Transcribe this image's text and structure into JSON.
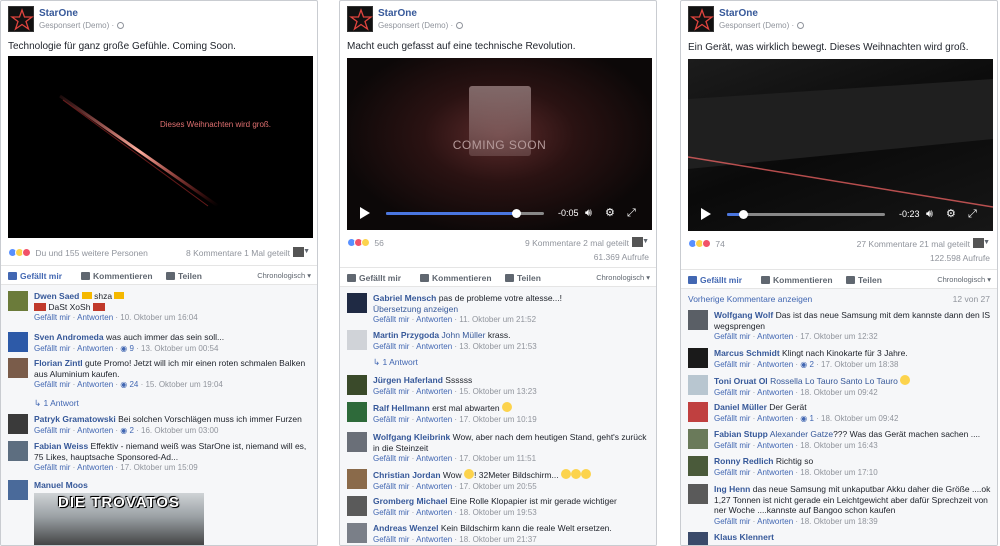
{
  "page_name": "StarOne",
  "sponsored": "Gesponsert (Demo) ·",
  "actions": {
    "like": "Gefällt mir",
    "comment": "Kommentieren",
    "share": "Teilen",
    "sort": "Chronologisch ▾"
  },
  "meta": {
    "like": "Gefällt mir",
    "reply": "Antworten"
  },
  "colors": {
    "link": "#365899",
    "accent": "#4267b2",
    "muted": "#90949c",
    "progress": "#4a76e0"
  },
  "posts": [
    {
      "text": "Technologie für ganz große Gefühle. Coming Soon.",
      "video_text": "Dieses Weihnachten wird groß.",
      "reactions": "Du und 155 weitere Personen",
      "counts": "8 Kommentare  1 Mal geteilt",
      "comments": [
        {
          "name": "Dwen Saed",
          "text": "shza",
          "extra": "DaSt XoSh",
          "time": "10. Oktober um 16:04",
          "likes": ""
        },
        {
          "name": "Sven Andromeda",
          "text": "was auch immer das sein soll...",
          "time": "13. Oktober um 00:54",
          "likes": "9"
        },
        {
          "name": "Florian Zintl",
          "text": "gute Promo! Jetzt will ich mir einen roten schmalen Balken aus Aluminium kaufen.",
          "time": "15. Oktober um 19:04",
          "likes": "24"
        },
        {
          "name": "Patryk Gramatowski",
          "text": "Bei solchen Vorschlägen muss ich immer Furzen",
          "time": "16. Oktober um 03:00",
          "likes": "2"
        },
        {
          "name": "Fabian Weiss",
          "text": "Effektiv - niemand weiß was StarOne ist, niemand will es, 75 Likes, hauptsache Sponsored-Ad...",
          "time": "17. Oktober um 15:09",
          "likes": ""
        },
        {
          "name": "Manuel Moos",
          "text": "",
          "time": "",
          "likes": ""
        }
      ],
      "reply_link": "1 Antwort",
      "image_text": "DIE TROVATOS"
    },
    {
      "text": "Macht euch gefasst auf eine technische Revolution.",
      "video_text": "COMING SOON",
      "time_left": "-0:05",
      "reactions": "56",
      "counts": "9 Kommentare  2 mal geteilt",
      "views": "61.369 Aufrufe",
      "comments": [
        {
          "name": "Gabriel Mensch",
          "text": "pas de probleme votre altesse...!",
          "sub": "Übersetzung anzeigen",
          "time": "11. Oktober um 21:52",
          "likes": ""
        },
        {
          "name": "Martin Przygoda",
          "tag": "John Müller",
          "text": "krass.",
          "time": "13. Oktober um 21:53",
          "likes": ""
        },
        {
          "name": "Jürgen Haferland",
          "text": "Ssssss",
          "time": "15. Oktober um 13:23",
          "likes": ""
        },
        {
          "name": "Ralf Hellmann",
          "text": "erst mal abwarten",
          "time": "17. Oktober um 10:19",
          "likes": ""
        },
        {
          "name": "Wolfgang Kleibrink",
          "text": "Wow, aber nach dem heutigen Stand, geht's zurück in die Steinzeit",
          "time": "17. Oktober um 11:51",
          "likes": ""
        },
        {
          "name": "Christian Jordan",
          "text": "Wow",
          "extra": "! 32Meter Bildschirm...",
          "time": "17. Oktober um 20:55",
          "likes": ""
        },
        {
          "name": "Gromberg Michael",
          "text": "Eine Rolle Klopapier ist mir gerade wichtiger",
          "time": "18. Oktober um 19:53",
          "likes": ""
        },
        {
          "name": "Andreas Wenzel",
          "text": "Kein Bildschirm kann die reale Welt ersetzen.",
          "time": "18. Oktober um 21:37",
          "likes": ""
        }
      ],
      "reply_link": "1 Antwort"
    },
    {
      "text": "Ein Gerät, was wirklich bewegt. Dieses Weihnachten wird groß.",
      "time_left": "-0:23",
      "reactions": "74",
      "counts": "27 Kommentare  21 mal geteilt",
      "views": "122.598 Aufrufe",
      "prev_comments": "Vorherige Kommentare anzeigen",
      "prev_count": "12 von 27",
      "comments": [
        {
          "name": "Wolfgang Wolf",
          "text": "Das ist das neue Samsung mit dem kannste dann den IS wegsprengen",
          "time": "17. Oktober um 12:32",
          "likes": ""
        },
        {
          "name": "Marcus Schmidt",
          "text": "Klingt nach Kinokarte für 3 Jahre.",
          "time": "17. Oktober um 18:38",
          "likes": "2"
        },
        {
          "name": "Toni Oruat Ol",
          "tag": "Rossella Lo Tauro Santo Lo Tauro",
          "text": "",
          "time": "18. Oktober um 09:42",
          "likes": ""
        },
        {
          "name": "Daniel Müller",
          "text": "Der Gerät",
          "time": "18. Oktober um 09:42",
          "likes": "1"
        },
        {
          "name": "Fabian Stupp",
          "tag": "Alexander Gatze",
          "text": "??? Was das Gerät machen sachen ....",
          "time": "18. Oktober um 16:43",
          "likes": ""
        },
        {
          "name": "Ronny Redlich",
          "text": "Richtig so",
          "time": "18. Oktober um 17:10",
          "likes": ""
        },
        {
          "name": "Ing Henn",
          "text": "das neue Samsung mit unkaputbar Akku daher die Größe ....ok 1,27 Tonnen ist nicht gerade ein Leichtgewicht aber dafür Sprechzeit von ner Woche ....kannste auf Bangoo schon kaufen",
          "time": "18. Oktober um 18:39",
          "likes": ""
        },
        {
          "name": "Klaus Klennert",
          "text": "",
          "time": "",
          "likes": ""
        }
      ]
    }
  ]
}
